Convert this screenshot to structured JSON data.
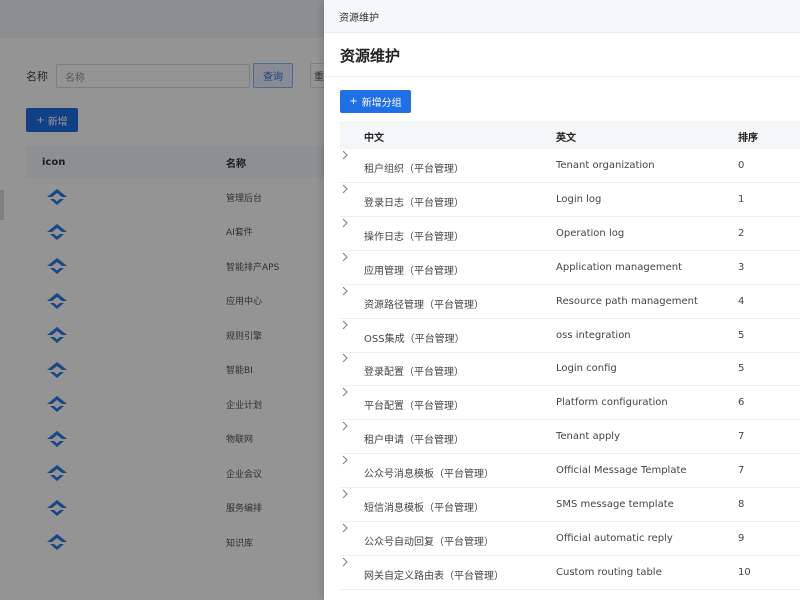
{
  "background": {
    "search": {
      "label": "名称",
      "placeholder": "名称",
      "query_button": "查询",
      "reset_button": "重"
    },
    "add_button": "新增",
    "table": {
      "headers": [
        "icon",
        "名称"
      ],
      "rows": [
        "管理后台",
        "AI套件",
        "智能排产APS",
        "应用中心",
        "规则引擎",
        "智能BI",
        "企业计划",
        "物联网",
        "企业会议",
        "服务编排",
        "知识库"
      ]
    }
  },
  "drawer": {
    "header_title": "资源维护",
    "title": "资源维护",
    "new_group_button": "新增分组",
    "table": {
      "headers": {
        "zh": "中文",
        "en": "英文",
        "order": "排序"
      },
      "rows": [
        {
          "zh": "租户组织（平台管理）",
          "en": "Tenant organization",
          "order": "0"
        },
        {
          "zh": "登录日志（平台管理）",
          "en": "Login log",
          "order": "1"
        },
        {
          "zh": "操作日志（平台管理）",
          "en": "Operation log",
          "order": "2"
        },
        {
          "zh": "应用管理（平台管理）",
          "en": "Application management",
          "order": "3"
        },
        {
          "zh": "资源路径管理（平台管理）",
          "en": "Resource path management",
          "order": "4"
        },
        {
          "zh": "OSS集成（平台管理）",
          "en": "oss integration",
          "order": "5"
        },
        {
          "zh": "登录配置（平台管理）",
          "en": "Login config",
          "order": "5"
        },
        {
          "zh": "平台配置（平台管理）",
          "en": "Platform configuration",
          "order": "6"
        },
        {
          "zh": "租户申请（平台管理）",
          "en": "Tenant apply",
          "order": "7"
        },
        {
          "zh": "公众号消息模板（平台管理）",
          "en": "Official Message Template",
          "order": "7"
        },
        {
          "zh": "短信消息模板（平台管理）",
          "en": "SMS message template",
          "order": "8"
        },
        {
          "zh": "公众号自动回复（平台管理）",
          "en": "Official automatic reply",
          "order": "9"
        },
        {
          "zh": "网关自定义路由表（平台管理）",
          "en": "Custom routing table",
          "order": "10"
        }
      ]
    }
  },
  "colors": {
    "primary": "#1f6fe5",
    "overlay": "rgba(0,0,0,0.42)",
    "icon": "#2a7be4"
  }
}
